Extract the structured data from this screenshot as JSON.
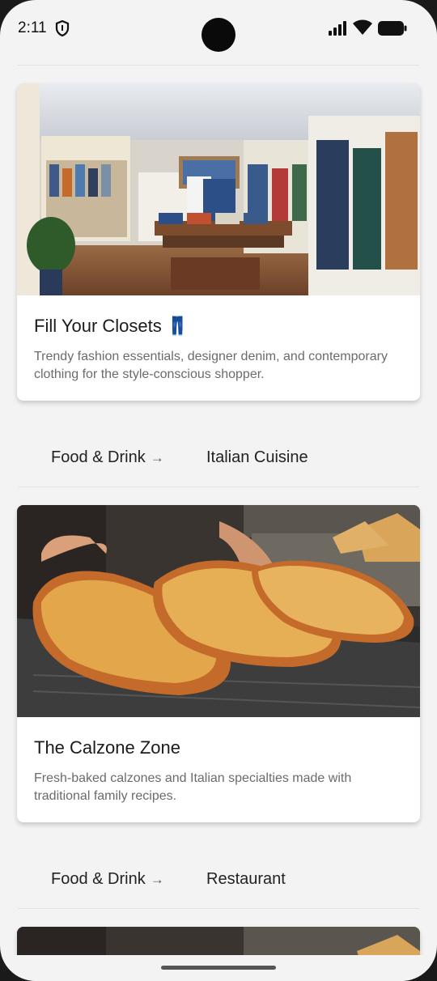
{
  "status": {
    "time": "2:11"
  },
  "cards": [
    {
      "title": "Fill Your Closets 👖",
      "description": "Trendy fashion essentials, designer denim, and contemporary clothing for the style-conscious shopper."
    },
    {
      "title": "The Calzone Zone",
      "description": "Fresh-baked calzones and Italian specialties made with traditional family recipes."
    }
  ],
  "categories": [
    {
      "parent": "Food & Drink",
      "arrow": "→",
      "child": "Italian Cuisine"
    },
    {
      "parent": "Food & Drink",
      "arrow": "→",
      "child": "Restaurant"
    }
  ]
}
